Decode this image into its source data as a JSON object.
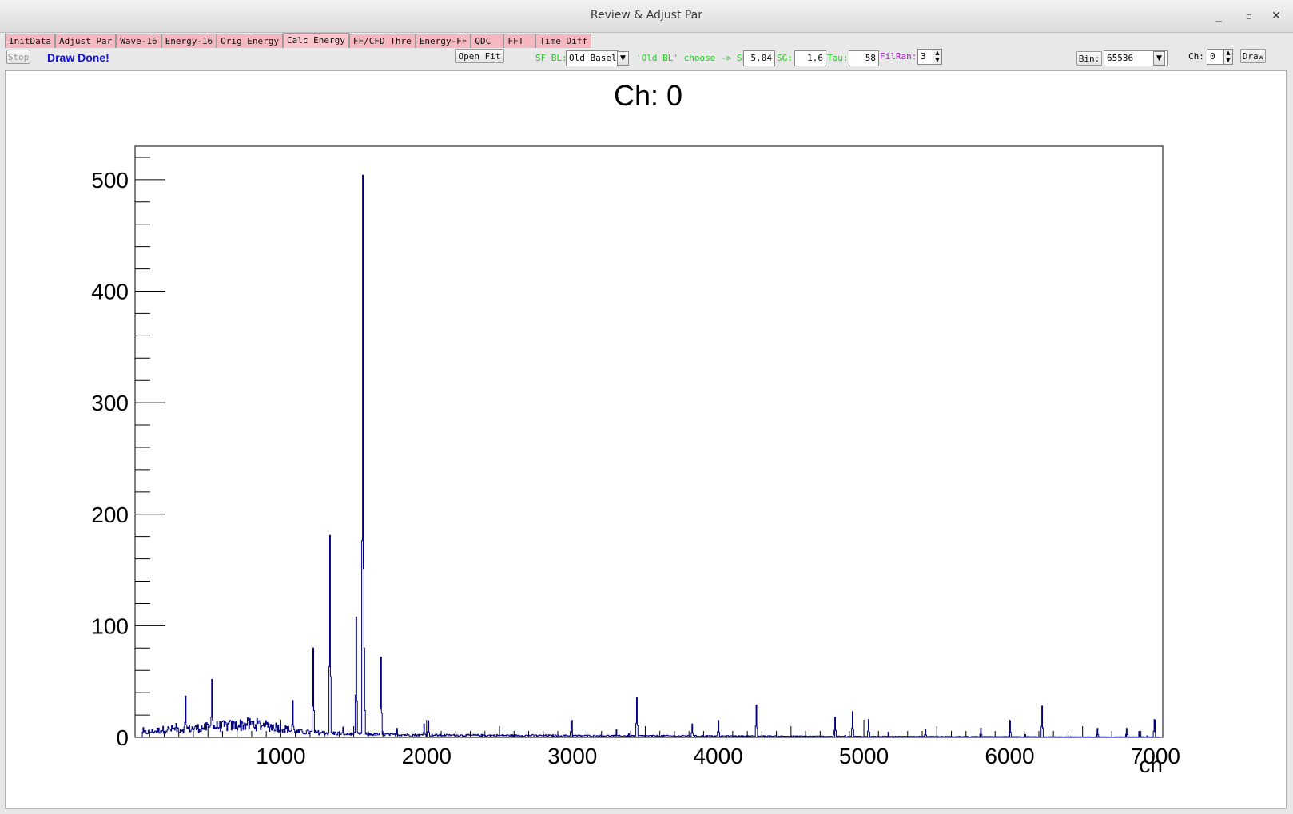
{
  "window": {
    "title": "Review & Adjust Par",
    "controls": {
      "minimize": "_",
      "maximize": "▫",
      "close": "✕"
    }
  },
  "tabs": [
    "InitData",
    "Adjust Par",
    "Wave-16",
    "Energy-16",
    "Orig Energy",
    "Calc Energy",
    "FF/CFD Thre",
    "Energy-FF",
    "QDC",
    "FFT",
    "Time Diff"
  ],
  "active_tab": "Calc Energy",
  "toolbar": {
    "stop_label": "Stop",
    "status": "Draw Done!",
    "open_fit_label": "Open  Fit",
    "sf_bl_label": "SF BL:",
    "sf_bl_value": "Old Baseli",
    "hint_label": "'Old BL' choose -> SL:",
    "sl_value": "5.04",
    "sg_label": "SG:",
    "sg_value": "1.6",
    "tau_label": "Tau:",
    "tau_value": "58",
    "filran_label": "FilRan:",
    "filran_value": "3",
    "bin_label": "Bin:",
    "bin_value": "65536",
    "ch_label": "Ch:",
    "ch_value": "0",
    "draw_label": "Draw"
  },
  "colors": {
    "status": "#1010d0",
    "green_label": "#22cc22",
    "purple_label": "#a020c0",
    "tab_bg": "#f5b8c0",
    "histogram": "#000080"
  },
  "chart_data": {
    "type": "histogram",
    "title": "Ch: 0",
    "xlabel": "ch",
    "ylabel": "",
    "xlim": [
      0,
      7050
    ],
    "ylim": [
      0,
      530
    ],
    "xticks": [
      "1000",
      "2000",
      "3000",
      "4000",
      "5000",
      "6000",
      "7000"
    ],
    "yticks": [
      "0",
      "100",
      "200",
      "300",
      "400",
      "500"
    ],
    "background_baseline": [
      {
        "x": 50,
        "y": 4
      },
      {
        "x": 200,
        "y": 7
      },
      {
        "x": 400,
        "y": 8
      },
      {
        "x": 600,
        "y": 10
      },
      {
        "x": 800,
        "y": 12
      },
      {
        "x": 1000,
        "y": 9
      },
      {
        "x": 1100,
        "y": 5
      },
      {
        "x": 1300,
        "y": 4
      },
      {
        "x": 1500,
        "y": 3
      },
      {
        "x": 2000,
        "y": 2
      },
      {
        "x": 3000,
        "y": 1.5
      },
      {
        "x": 4000,
        "y": 1.2
      },
      {
        "x": 5000,
        "y": 0.8
      },
      {
        "x": 6000,
        "y": 0.5
      },
      {
        "x": 7050,
        "y": 0.3
      }
    ],
    "peaks": [
      {
        "x": 345,
        "y": 37
      },
      {
        "x": 525,
        "y": 52
      },
      {
        "x": 1080,
        "y": 33
      },
      {
        "x": 1220,
        "y": 80
      },
      {
        "x": 1335,
        "y": 181
      },
      {
        "x": 1515,
        "y": 108
      },
      {
        "x": 1560,
        "y": 504
      },
      {
        "x": 1572,
        "y": 80
      },
      {
        "x": 1685,
        "y": 72
      },
      {
        "x": 1795,
        "y": 8
      },
      {
        "x": 1980,
        "y": 12
      },
      {
        "x": 2010,
        "y": 15
      },
      {
        "x": 2990,
        "y": 15
      },
      {
        "x": 3440,
        "y": 36
      },
      {
        "x": 3820,
        "y": 12
      },
      {
        "x": 4000,
        "y": 15
      },
      {
        "x": 4260,
        "y": 29
      },
      {
        "x": 4800,
        "y": 18
      },
      {
        "x": 4920,
        "y": 23
      },
      {
        "x": 5030,
        "y": 16
      },
      {
        "x": 5420,
        "y": 7
      },
      {
        "x": 5800,
        "y": 8
      },
      {
        "x": 6000,
        "y": 15
      },
      {
        "x": 6220,
        "y": 28
      },
      {
        "x": 6600,
        "y": 8
      },
      {
        "x": 6800,
        "y": 8
      },
      {
        "x": 6990,
        "y": 16
      }
    ]
  }
}
